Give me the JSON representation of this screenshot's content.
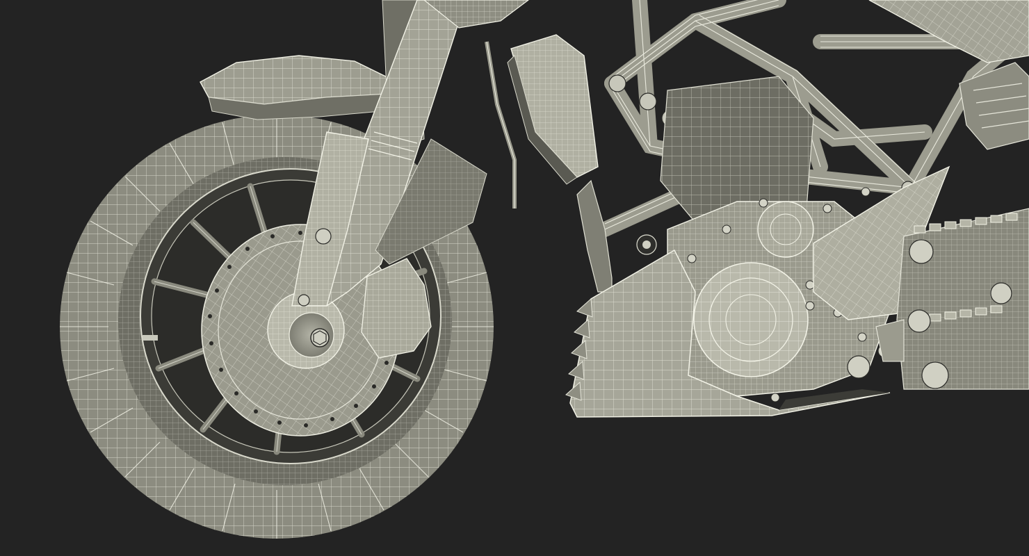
{
  "scene": {
    "subject": "wireframe-motorcycle-front-render",
    "colors": {
      "background": "#232323",
      "surface_light": "#a7a79a",
      "surface_mid": "#86867a",
      "surface_dark": "#55554d",
      "surface_deep": "#3a3a35",
      "wire": "#f2f2e6"
    }
  }
}
